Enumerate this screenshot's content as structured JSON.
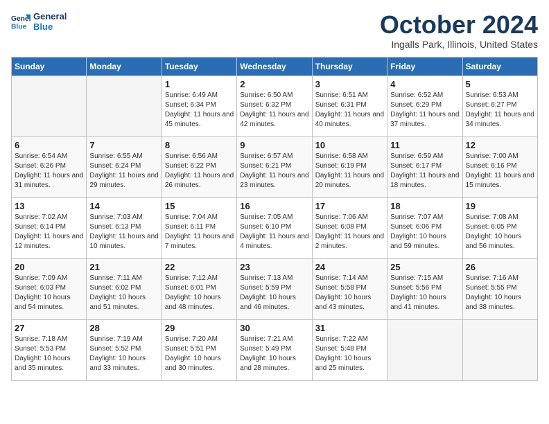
{
  "header": {
    "logo_line1": "General",
    "logo_line2": "Blue",
    "month": "October 2024",
    "location": "Ingalls Park, Illinois, United States"
  },
  "weekdays": [
    "Sunday",
    "Monday",
    "Tuesday",
    "Wednesday",
    "Thursday",
    "Friday",
    "Saturday"
  ],
  "weeks": [
    [
      {
        "day": "",
        "sunrise": "",
        "sunset": "",
        "daylight": ""
      },
      {
        "day": "",
        "sunrise": "",
        "sunset": "",
        "daylight": ""
      },
      {
        "day": "1",
        "sunrise": "Sunrise: 6:49 AM",
        "sunset": "Sunset: 6:34 PM",
        "daylight": "Daylight: 11 hours and 45 minutes."
      },
      {
        "day": "2",
        "sunrise": "Sunrise: 6:50 AM",
        "sunset": "Sunset: 6:32 PM",
        "daylight": "Daylight: 11 hours and 42 minutes."
      },
      {
        "day": "3",
        "sunrise": "Sunrise: 6:51 AM",
        "sunset": "Sunset: 6:31 PM",
        "daylight": "Daylight: 11 hours and 40 minutes."
      },
      {
        "day": "4",
        "sunrise": "Sunrise: 6:52 AM",
        "sunset": "Sunset: 6:29 PM",
        "daylight": "Daylight: 11 hours and 37 minutes."
      },
      {
        "day": "5",
        "sunrise": "Sunrise: 6:53 AM",
        "sunset": "Sunset: 6:27 PM",
        "daylight": "Daylight: 11 hours and 34 minutes."
      }
    ],
    [
      {
        "day": "6",
        "sunrise": "Sunrise: 6:54 AM",
        "sunset": "Sunset: 6:26 PM",
        "daylight": "Daylight: 11 hours and 31 minutes."
      },
      {
        "day": "7",
        "sunrise": "Sunrise: 6:55 AM",
        "sunset": "Sunset: 6:24 PM",
        "daylight": "Daylight: 11 hours and 29 minutes."
      },
      {
        "day": "8",
        "sunrise": "Sunrise: 6:56 AM",
        "sunset": "Sunset: 6:22 PM",
        "daylight": "Daylight: 11 hours and 26 minutes."
      },
      {
        "day": "9",
        "sunrise": "Sunrise: 6:57 AM",
        "sunset": "Sunset: 6:21 PM",
        "daylight": "Daylight: 11 hours and 23 minutes."
      },
      {
        "day": "10",
        "sunrise": "Sunrise: 6:58 AM",
        "sunset": "Sunset: 6:19 PM",
        "daylight": "Daylight: 11 hours and 20 minutes."
      },
      {
        "day": "11",
        "sunrise": "Sunrise: 6:59 AM",
        "sunset": "Sunset: 6:17 PM",
        "daylight": "Daylight: 11 hours and 18 minutes."
      },
      {
        "day": "12",
        "sunrise": "Sunrise: 7:00 AM",
        "sunset": "Sunset: 6:16 PM",
        "daylight": "Daylight: 11 hours and 15 minutes."
      }
    ],
    [
      {
        "day": "13",
        "sunrise": "Sunrise: 7:02 AM",
        "sunset": "Sunset: 6:14 PM",
        "daylight": "Daylight: 11 hours and 12 minutes."
      },
      {
        "day": "14",
        "sunrise": "Sunrise: 7:03 AM",
        "sunset": "Sunset: 6:13 PM",
        "daylight": "Daylight: 11 hours and 10 minutes."
      },
      {
        "day": "15",
        "sunrise": "Sunrise: 7:04 AM",
        "sunset": "Sunset: 6:11 PM",
        "daylight": "Daylight: 11 hours and 7 minutes."
      },
      {
        "day": "16",
        "sunrise": "Sunrise: 7:05 AM",
        "sunset": "Sunset: 6:10 PM",
        "daylight": "Daylight: 11 hours and 4 minutes."
      },
      {
        "day": "17",
        "sunrise": "Sunrise: 7:06 AM",
        "sunset": "Sunset: 6:08 PM",
        "daylight": "Daylight: 11 hours and 2 minutes."
      },
      {
        "day": "18",
        "sunrise": "Sunrise: 7:07 AM",
        "sunset": "Sunset: 6:06 PM",
        "daylight": "Daylight: 10 hours and 59 minutes."
      },
      {
        "day": "19",
        "sunrise": "Sunrise: 7:08 AM",
        "sunset": "Sunset: 6:05 PM",
        "daylight": "Daylight: 10 hours and 56 minutes."
      }
    ],
    [
      {
        "day": "20",
        "sunrise": "Sunrise: 7:09 AM",
        "sunset": "Sunset: 6:03 PM",
        "daylight": "Daylight: 10 hours and 54 minutes."
      },
      {
        "day": "21",
        "sunrise": "Sunrise: 7:11 AM",
        "sunset": "Sunset: 6:02 PM",
        "daylight": "Daylight: 10 hours and 51 minutes."
      },
      {
        "day": "22",
        "sunrise": "Sunrise: 7:12 AM",
        "sunset": "Sunset: 6:01 PM",
        "daylight": "Daylight: 10 hours and 48 minutes."
      },
      {
        "day": "23",
        "sunrise": "Sunrise: 7:13 AM",
        "sunset": "Sunset: 5:59 PM",
        "daylight": "Daylight: 10 hours and 46 minutes."
      },
      {
        "day": "24",
        "sunrise": "Sunrise: 7:14 AM",
        "sunset": "Sunset: 5:58 PM",
        "daylight": "Daylight: 10 hours and 43 minutes."
      },
      {
        "day": "25",
        "sunrise": "Sunrise: 7:15 AM",
        "sunset": "Sunset: 5:56 PM",
        "daylight": "Daylight: 10 hours and 41 minutes."
      },
      {
        "day": "26",
        "sunrise": "Sunrise: 7:16 AM",
        "sunset": "Sunset: 5:55 PM",
        "daylight": "Daylight: 10 hours and 38 minutes."
      }
    ],
    [
      {
        "day": "27",
        "sunrise": "Sunrise: 7:18 AM",
        "sunset": "Sunset: 5:53 PM",
        "daylight": "Daylight: 10 hours and 35 minutes."
      },
      {
        "day": "28",
        "sunrise": "Sunrise: 7:19 AM",
        "sunset": "Sunset: 5:52 PM",
        "daylight": "Daylight: 10 hours and 33 minutes."
      },
      {
        "day": "29",
        "sunrise": "Sunrise: 7:20 AM",
        "sunset": "Sunset: 5:51 PM",
        "daylight": "Daylight: 10 hours and 30 minutes."
      },
      {
        "day": "30",
        "sunrise": "Sunrise: 7:21 AM",
        "sunset": "Sunset: 5:49 PM",
        "daylight": "Daylight: 10 hours and 28 minutes."
      },
      {
        "day": "31",
        "sunrise": "Sunrise: 7:22 AM",
        "sunset": "Sunset: 5:48 PM",
        "daylight": "Daylight: 10 hours and 25 minutes."
      },
      {
        "day": "",
        "sunrise": "",
        "sunset": "",
        "daylight": ""
      },
      {
        "day": "",
        "sunrise": "",
        "sunset": "",
        "daylight": ""
      }
    ]
  ]
}
